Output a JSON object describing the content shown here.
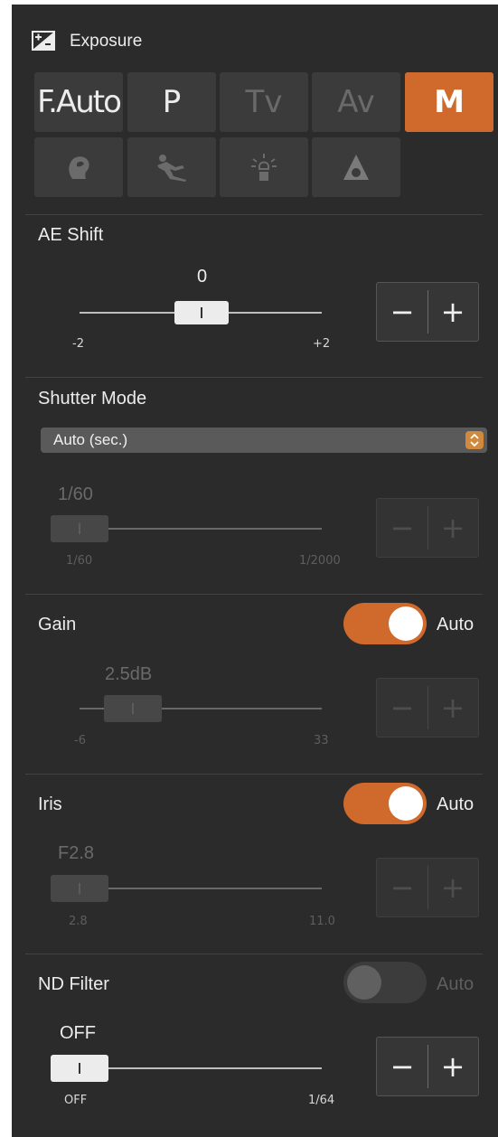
{
  "header": {
    "title": "Exposure",
    "icon": "exposure-compensation-icon"
  },
  "modes": [
    {
      "label": "F.Auto",
      "state": "normal"
    },
    {
      "label": "P",
      "state": "normal"
    },
    {
      "label": "Tv",
      "state": "disabled"
    },
    {
      "label": "Av",
      "state": "disabled"
    },
    {
      "label": "M",
      "state": "selected"
    }
  ],
  "scene_modes": [
    {
      "icon": "portrait-icon"
    },
    {
      "icon": "sports-icon"
    },
    {
      "icon": "spotlight-icon"
    },
    {
      "icon": "low-light-icon"
    }
  ],
  "ae_shift": {
    "title": "AE Shift",
    "value": "0",
    "min_label": "-2",
    "max_label": "+2",
    "enabled": true,
    "stepper": {
      "minus": "−",
      "plus": "+"
    }
  },
  "shutter": {
    "title": "Shutter Mode",
    "mode_select": {
      "selected": "Auto (sec.)"
    },
    "value": "1/60",
    "min_label": "1/60",
    "max_label": "1/2000",
    "enabled": false,
    "stepper": {
      "minus": "−",
      "plus": "+"
    }
  },
  "gain": {
    "title": "Gain",
    "auto_label": "Auto",
    "auto_on": true,
    "value": "2.5dB",
    "min_label": "-6",
    "max_label": "33",
    "enabled": false,
    "stepper": {
      "minus": "−",
      "plus": "+"
    }
  },
  "iris": {
    "title": "Iris",
    "auto_label": "Auto",
    "auto_on": true,
    "value": "F2.8",
    "min_label": "2.8",
    "max_label": "11.0",
    "enabled": false,
    "stepper": {
      "minus": "−",
      "plus": "+"
    }
  },
  "nd_filter": {
    "title": "ND Filter",
    "auto_label": "Auto",
    "auto_on": false,
    "value": "OFF",
    "min_label": "OFF",
    "max_label": "1/64",
    "enabled": true,
    "stepper": {
      "minus": "−",
      "plus": "+"
    }
  },
  "colors": {
    "accent": "#cf6a2c",
    "panel": "#2b2b2b",
    "button": "#3b3b3b"
  }
}
